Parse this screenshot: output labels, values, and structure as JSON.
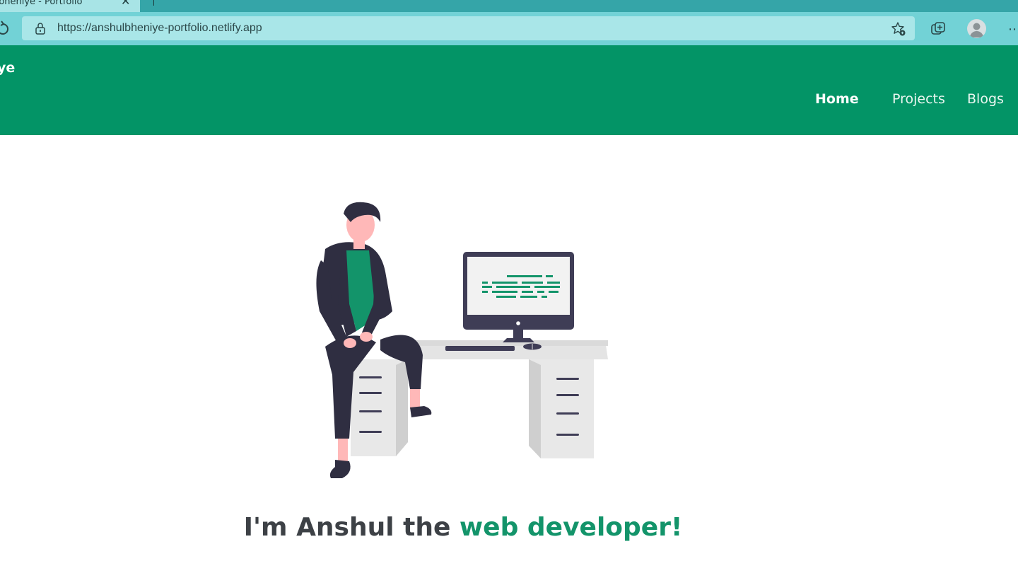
{
  "browser": {
    "tab_title": "bheniye - Portfolio",
    "url": "https://anshulbheniye-portfolio.netlify.app"
  },
  "site": {
    "brand": "ye",
    "nav": [
      {
        "label": "Home",
        "active": true
      },
      {
        "label": "Projects",
        "active": false
      },
      {
        "label": "Blogs",
        "active": false
      }
    ]
  },
  "hero": {
    "headline_prefix": "I'm Anshul the ",
    "headline_accent": "web developer!",
    "illustration": "developer-at-desk-illustration"
  },
  "colors": {
    "nav_bg": "#039466",
    "accent_green": "#13946a",
    "headline_text": "#3d4146",
    "chrome_toolbar": "#72d2d6"
  }
}
